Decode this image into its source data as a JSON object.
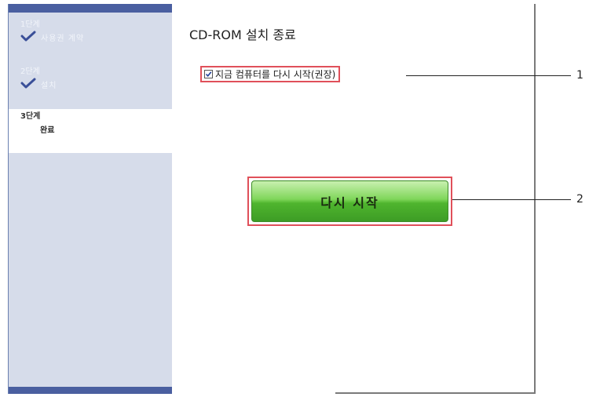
{
  "sidebar": {
    "steps": [
      {
        "number": "1단계",
        "label": "사용권 계약",
        "completed": true,
        "icon": "check-icon"
      },
      {
        "number": "2단계",
        "label": "설치",
        "completed": true,
        "icon": "check-icon"
      },
      {
        "number": "3단계",
        "label": "완료",
        "completed": false,
        "active": true
      }
    ]
  },
  "main": {
    "title": "CD-ROM 설치 종료",
    "restart_checkbox": {
      "label": "지금 컴퓨터를 다시 시작(권장)",
      "checked": true
    },
    "restart_button_label": "다시 시작"
  },
  "callouts": [
    "1",
    "2"
  ],
  "colors": {
    "sidebar_bg": "#d6dcea",
    "sidebar_bar": "#4a5fa0",
    "highlight_box": "#e0505a",
    "button_green": "#4fb52e"
  }
}
